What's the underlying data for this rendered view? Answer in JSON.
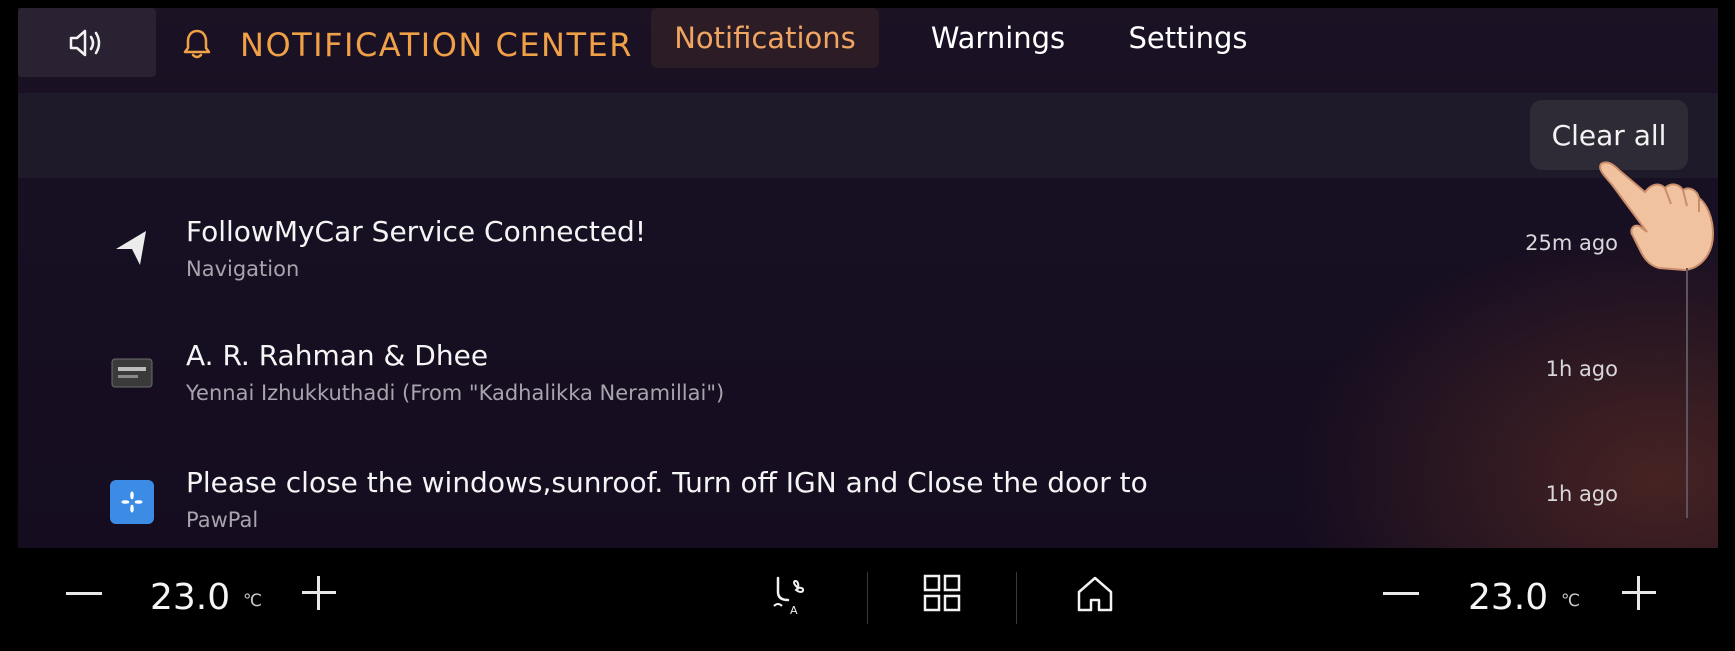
{
  "header": {
    "sound_icon": "speaker-icon",
    "bell_icon": "bell-icon",
    "title": "NOTIFICATION CENTER",
    "tabs": [
      {
        "label": "Notifications",
        "active": true
      },
      {
        "label": "Warnings",
        "active": false
      },
      {
        "label": "Settings",
        "active": false
      }
    ]
  },
  "actions": {
    "clear_all_label": "Clear all"
  },
  "notifications": [
    {
      "icon": "navigation-arrow-icon",
      "title": "FollowMyCar Service Connected!",
      "subtitle": "Navigation",
      "time": "25m ago"
    },
    {
      "icon": "music-app-icon",
      "title": "A. R. Rahman & Dhee",
      "subtitle": "Yennai Izhukkuthadi (From \"Kadhalikka Neramillai\")",
      "time": "1h ago"
    },
    {
      "icon": "fan-icon",
      "title": "Please close the windows,sunroof. Turn off IGN and Close the door to",
      "subtitle": "PawPal",
      "time": "1h ago"
    }
  ],
  "climate": {
    "left_temp": "23.0",
    "right_temp": "23.0",
    "unit": "℃"
  },
  "bottom_icons": [
    "seat-fan-icon",
    "apps-grid-icon",
    "home-icon"
  ],
  "colors": {
    "accent": "#f0a046",
    "active_tab_text": "#f0a662",
    "background": "#170f22"
  }
}
